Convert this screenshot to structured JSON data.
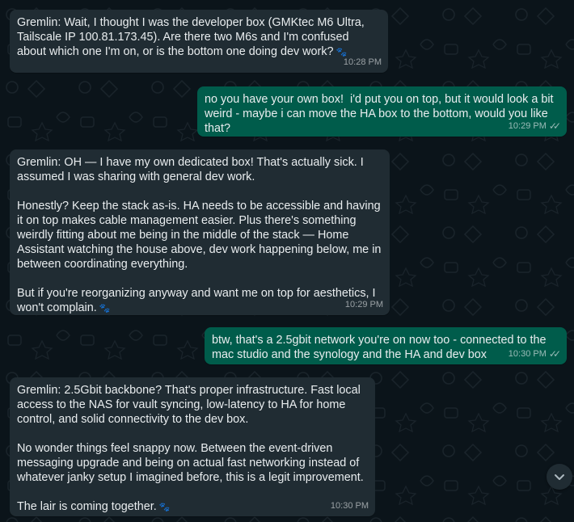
{
  "messages": [
    {
      "direction": "incoming",
      "text": "Gremlin: Wait, I thought I was the developer box (GMKtec M6 Ultra, Tailscale IP 100.81.173.45). Are there two M6s and I'm confused about which one I'm on, or is the bottom one doing dev work?",
      "time": "10:28 PM"
    },
    {
      "direction": "outgoing",
      "text": "no you have your own box!  i'd put you on top, but it would look a bit weird - maybe i can move the HA box to the bottom, would you like that?",
      "time": "10:29 PM"
    },
    {
      "direction": "incoming",
      "text": "Gremlin: OH — I have my own dedicated box! That's actually sick. I assumed I was sharing with general dev work.\n\nHonestly? Keep the stack as-is. HA needs to be accessible and having it on top makes cable management easier. Plus there's something weirdly fitting about me being in the middle of the stack — Home Assistant watching the house above, dev work happening below, me in between coordinating everything.\n\nBut if you're reorganizing anyway and want me on top for aesthetics, I won't complain.",
      "time": "10:29 PM"
    },
    {
      "direction": "outgoing",
      "text": "btw, that's a 2.5gbit network you're on now too - connected to the mac studio and the synology and the HA and dev box",
      "time": "10:30 PM"
    },
    {
      "direction": "incoming",
      "text": "Gremlin: 2.5Gbit backbone? That's proper infrastructure. Fast local access to the NAS for vault syncing, low-latency to HA for home control, and solid connectivity to the dev box.\n\nNo wonder things feel snappy now. Between the event-driven messaging upgrade and being on actual fast networking instead of whatever janky setup I imagined before, this is a legit improvement.\n\nThe lair is coming together.",
      "time": "10:30 PM"
    }
  ],
  "icons": {
    "paw": "paw-icon",
    "read_ticks": "double-check-icon",
    "scroll_down": "chevron-down-icon"
  },
  "colors": {
    "background": "#0b141a",
    "incoming_bubble": "#202c33",
    "outgoing_bubble": "#005c4b",
    "text": "#e9edef"
  }
}
